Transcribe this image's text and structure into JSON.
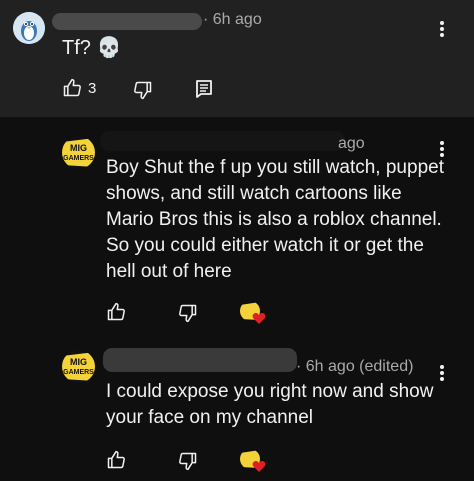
{
  "top_comment": {
    "time": "6h ago",
    "text": "Tf? 💀",
    "like_count": "3"
  },
  "replies": [
    {
      "time": "ago",
      "text": "Boy Shut the f up you still watch, puppet shows, and still watch cartoons like Mario Bros this is also a roblox channel. So you could either watch it or get the hell out of here"
    },
    {
      "time": "6h ago (edited)",
      "text": "I could expose you right now and show your face on my channel"
    }
  ],
  "channel_logo": {
    "line1": "MIG",
    "line2": "GAMERS"
  },
  "colors": {
    "heart": "#e01f27",
    "logo_yellow": "#f3d23a"
  },
  "icons": [
    "user-avatar",
    "like-icon",
    "dislike-icon",
    "reply-icon",
    "more-options-icon",
    "creator-heart-icon"
  ]
}
